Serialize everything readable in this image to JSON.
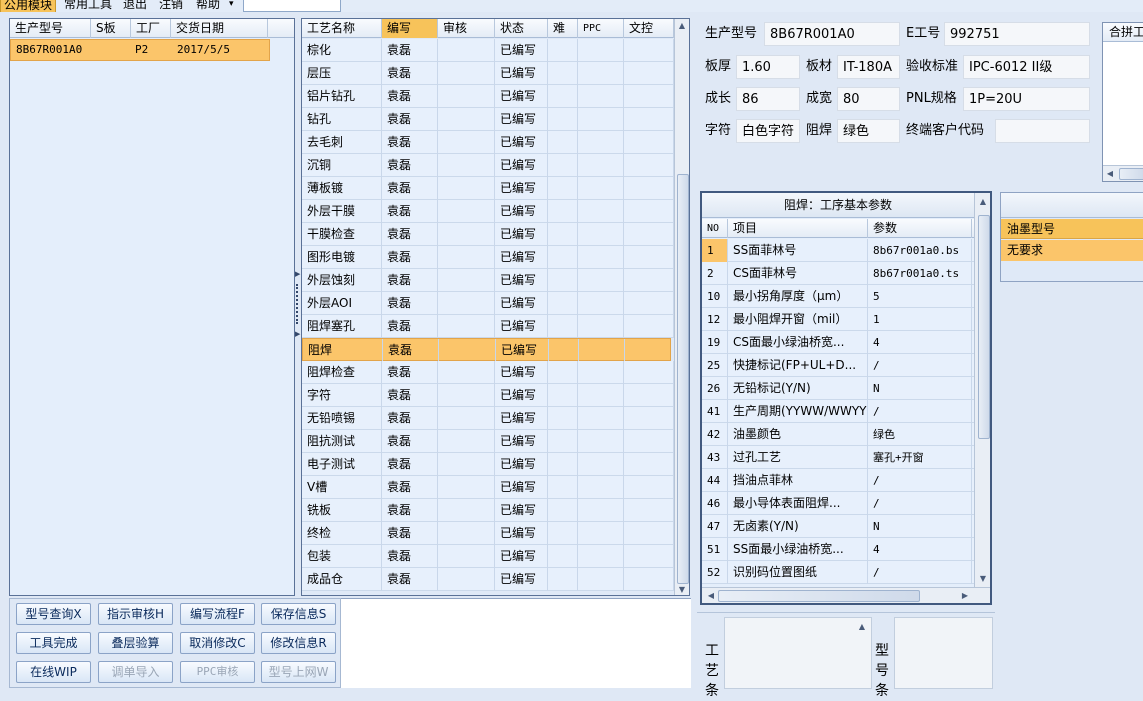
{
  "menu": {
    "items": [
      "公用模块",
      "常用工具",
      "退出",
      "注销",
      "帮助"
    ],
    "active_index": 0,
    "dropdown_indicator": "▾"
  },
  "left_grid": {
    "headers": [
      "生产型号",
      "S板",
      "工厂",
      "交货日期"
    ],
    "rows": [
      [
        "8B67R001A0",
        "",
        "P2",
        "2017/5/5"
      ]
    ]
  },
  "process_grid": {
    "headers": [
      "工艺名称",
      "编写",
      "审核",
      "状态",
      "难",
      "PPC",
      "文控"
    ],
    "selected_header_index": 1,
    "rows": [
      [
        "棕化",
        "袁磊",
        "",
        "已编写"
      ],
      [
        "层压",
        "袁磊",
        "",
        "已编写"
      ],
      [
        "铝片钻孔",
        "袁磊",
        "",
        "已编写"
      ],
      [
        "钻孔",
        "袁磊",
        "",
        "已编写"
      ],
      [
        "去毛刺",
        "袁磊",
        "",
        "已编写"
      ],
      [
        "沉铜",
        "袁磊",
        "",
        "已编写"
      ],
      [
        "薄板镀",
        "袁磊",
        "",
        "已编写"
      ],
      [
        "外层干膜",
        "袁磊",
        "",
        "已编写"
      ],
      [
        "干膜检查",
        "袁磊",
        "",
        "已编写"
      ],
      [
        "图形电镀",
        "袁磊",
        "",
        "已编写"
      ],
      [
        "外层蚀刻",
        "袁磊",
        "",
        "已编写"
      ],
      [
        "外层AOI",
        "袁磊",
        "",
        "已编写"
      ],
      [
        "阻焊塞孔",
        "袁磊",
        "",
        "已编写"
      ],
      [
        "阻焊",
        "袁磊",
        "",
        "已编写"
      ],
      [
        "阻焊检查",
        "袁磊",
        "",
        "已编写"
      ],
      [
        "字符",
        "袁磊",
        "",
        "已编写"
      ],
      [
        "无铅喷锡",
        "袁磊",
        "",
        "已编写"
      ],
      [
        "阻抗测试",
        "袁磊",
        "",
        "已编写"
      ],
      [
        "电子测试",
        "袁磊",
        "",
        "已编写"
      ],
      [
        "V槽",
        "袁磊",
        "",
        "已编写"
      ],
      [
        "铣板",
        "袁磊",
        "",
        "已编写"
      ],
      [
        "终检",
        "袁磊",
        "",
        "已编写"
      ],
      [
        "包装",
        "袁磊",
        "",
        "已编写"
      ],
      [
        "成品仓",
        "袁磊",
        "",
        "已编写"
      ]
    ],
    "selected_row_index": 13
  },
  "info": {
    "model_label": "生产型号",
    "model_value": "8B67R001A0",
    "e_label": "E工号",
    "e_value": "992751",
    "thickness_label": "板厚",
    "thickness_value": "1.60",
    "material_label": "板材",
    "material_value": "IT-180A",
    "standard_label": "验收标准",
    "standard_value": "IPC-6012 II级",
    "length_label": "成长",
    "length_value": "86",
    "width_label": "成宽",
    "width_value": "80",
    "pnl_label": "PNL规格",
    "pnl_value": "1P=20U",
    "char_label": "字符",
    "char_value": "白色字符",
    "mask_label": "阻焊",
    "mask_value": "绿色",
    "customer_label": "终端客户代码",
    "customer_value": "",
    "merge_label": "合拼工"
  },
  "param_grid": {
    "title": "阻焊：工序基本参数",
    "headers": [
      "NO",
      "项目",
      "参数"
    ],
    "rows": [
      [
        "1",
        "SS面菲林号",
        "8b67r001a0.bs"
      ],
      [
        "2",
        "CS面菲林号",
        "8b67r001a0.ts"
      ],
      [
        "10",
        "最小拐角厚度（μm）",
        "5"
      ],
      [
        "12",
        "最小阻焊开窗（mil）",
        "1"
      ],
      [
        "19",
        "CS面最小绿油桥宽...",
        "4"
      ],
      [
        "25",
        "快捷标记(FP+UL+D...",
        "/"
      ],
      [
        "26",
        "无铅标记(Y/N)",
        "N"
      ],
      [
        "41",
        "生产周期(YYWW/WWYY)",
        "/"
      ],
      [
        "42",
        "油墨颜色",
        "绿色"
      ],
      [
        "43",
        "过孔工艺",
        "塞孔+开窗"
      ],
      [
        "44",
        "挡油点菲林",
        "/"
      ],
      [
        "46",
        "最小导体表面阻焊...",
        "/"
      ],
      [
        "47",
        "无卤素(Y/N)",
        "N"
      ],
      [
        "51",
        "SS面最小绿油桥宽...",
        "4"
      ],
      [
        "52",
        "识别码位置图纸",
        "/"
      ]
    ],
    "selected_row_index": 0
  },
  "ink_grid": {
    "header": "油墨型号",
    "rows": [
      "无要求"
    ]
  },
  "buttons": [
    {
      "label": "型号查询X",
      "enabled": true
    },
    {
      "label": "指示审核H",
      "enabled": true
    },
    {
      "label": "编写流程F",
      "enabled": true
    },
    {
      "label": "保存信息S",
      "enabled": true
    },
    {
      "label": "工具完成",
      "enabled": true
    },
    {
      "label": "叠层验算",
      "enabled": true
    },
    {
      "label": "取消修改C",
      "enabled": true
    },
    {
      "label": "修改信息R",
      "enabled": true
    },
    {
      "label": "在线WIP",
      "enabled": true
    },
    {
      "label": "调单导入",
      "enabled": false
    },
    {
      "label": "PPC审核",
      "enabled": false
    },
    {
      "label": "型号上网W",
      "enabled": false
    }
  ],
  "bottom_labels": {
    "process_label": "工艺条",
    "model_label": "型号条"
  }
}
